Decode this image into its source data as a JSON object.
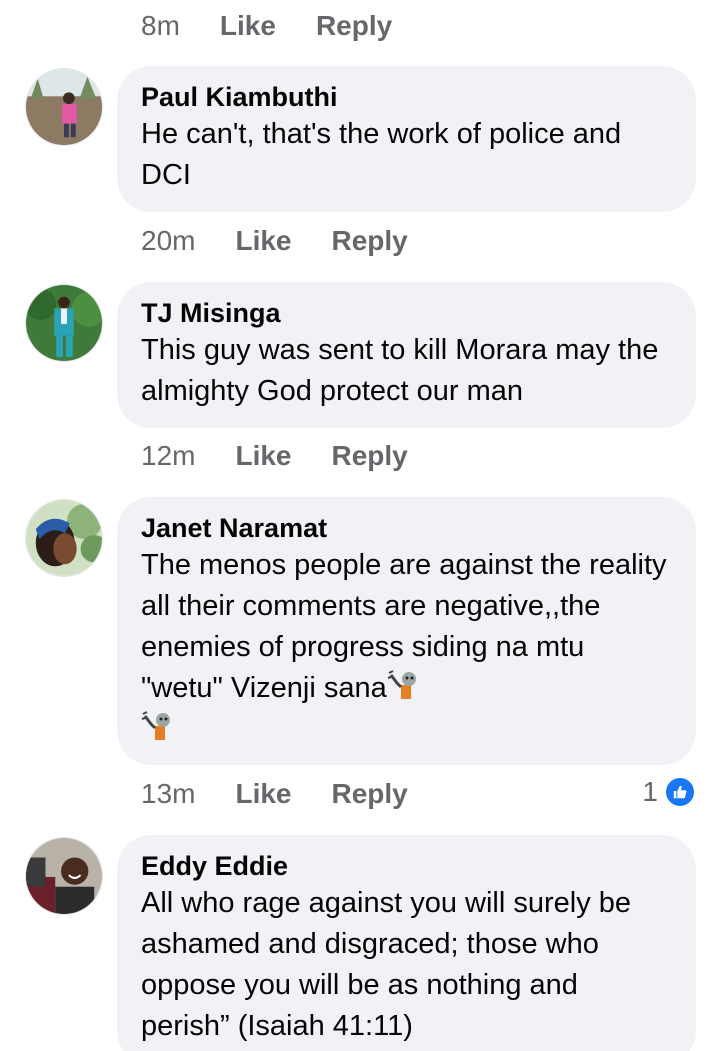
{
  "top_actions": {
    "time": "8m",
    "like": "Like",
    "reply": "Reply"
  },
  "comments": [
    {
      "author": "Paul Kiambuthi",
      "text": "He can't, that's the work of police and DCI",
      "time": "20m",
      "like": "Like",
      "reply": "Reply"
    },
    {
      "author": "TJ Misinga",
      "text": "This guy was sent to kill Morara may the almighty God protect our man",
      "time": "12m",
      "like": "Like",
      "reply": "Reply"
    },
    {
      "author": "Janet Naramat",
      "text": "The menos people are against the reality all their comments are negative,,the enemies of progress siding na mtu \"wetu\" Vizenji sana",
      "emoji": "zombie-emoji",
      "time": "13m",
      "like": "Like",
      "reply": "Reply",
      "reaction_count": "1",
      "reaction_icon": "like-thumb-icon"
    },
    {
      "author": "Eddy Eddie",
      "text": "All who rage against you will surely be ashamed and disgraced; those who oppose you will be as nothing and perish” (Isaiah 41:11)"
    }
  ],
  "colors": {
    "bubble": "#f0f2f5",
    "meta": "#65676b",
    "like_blue": "#1877f2"
  }
}
